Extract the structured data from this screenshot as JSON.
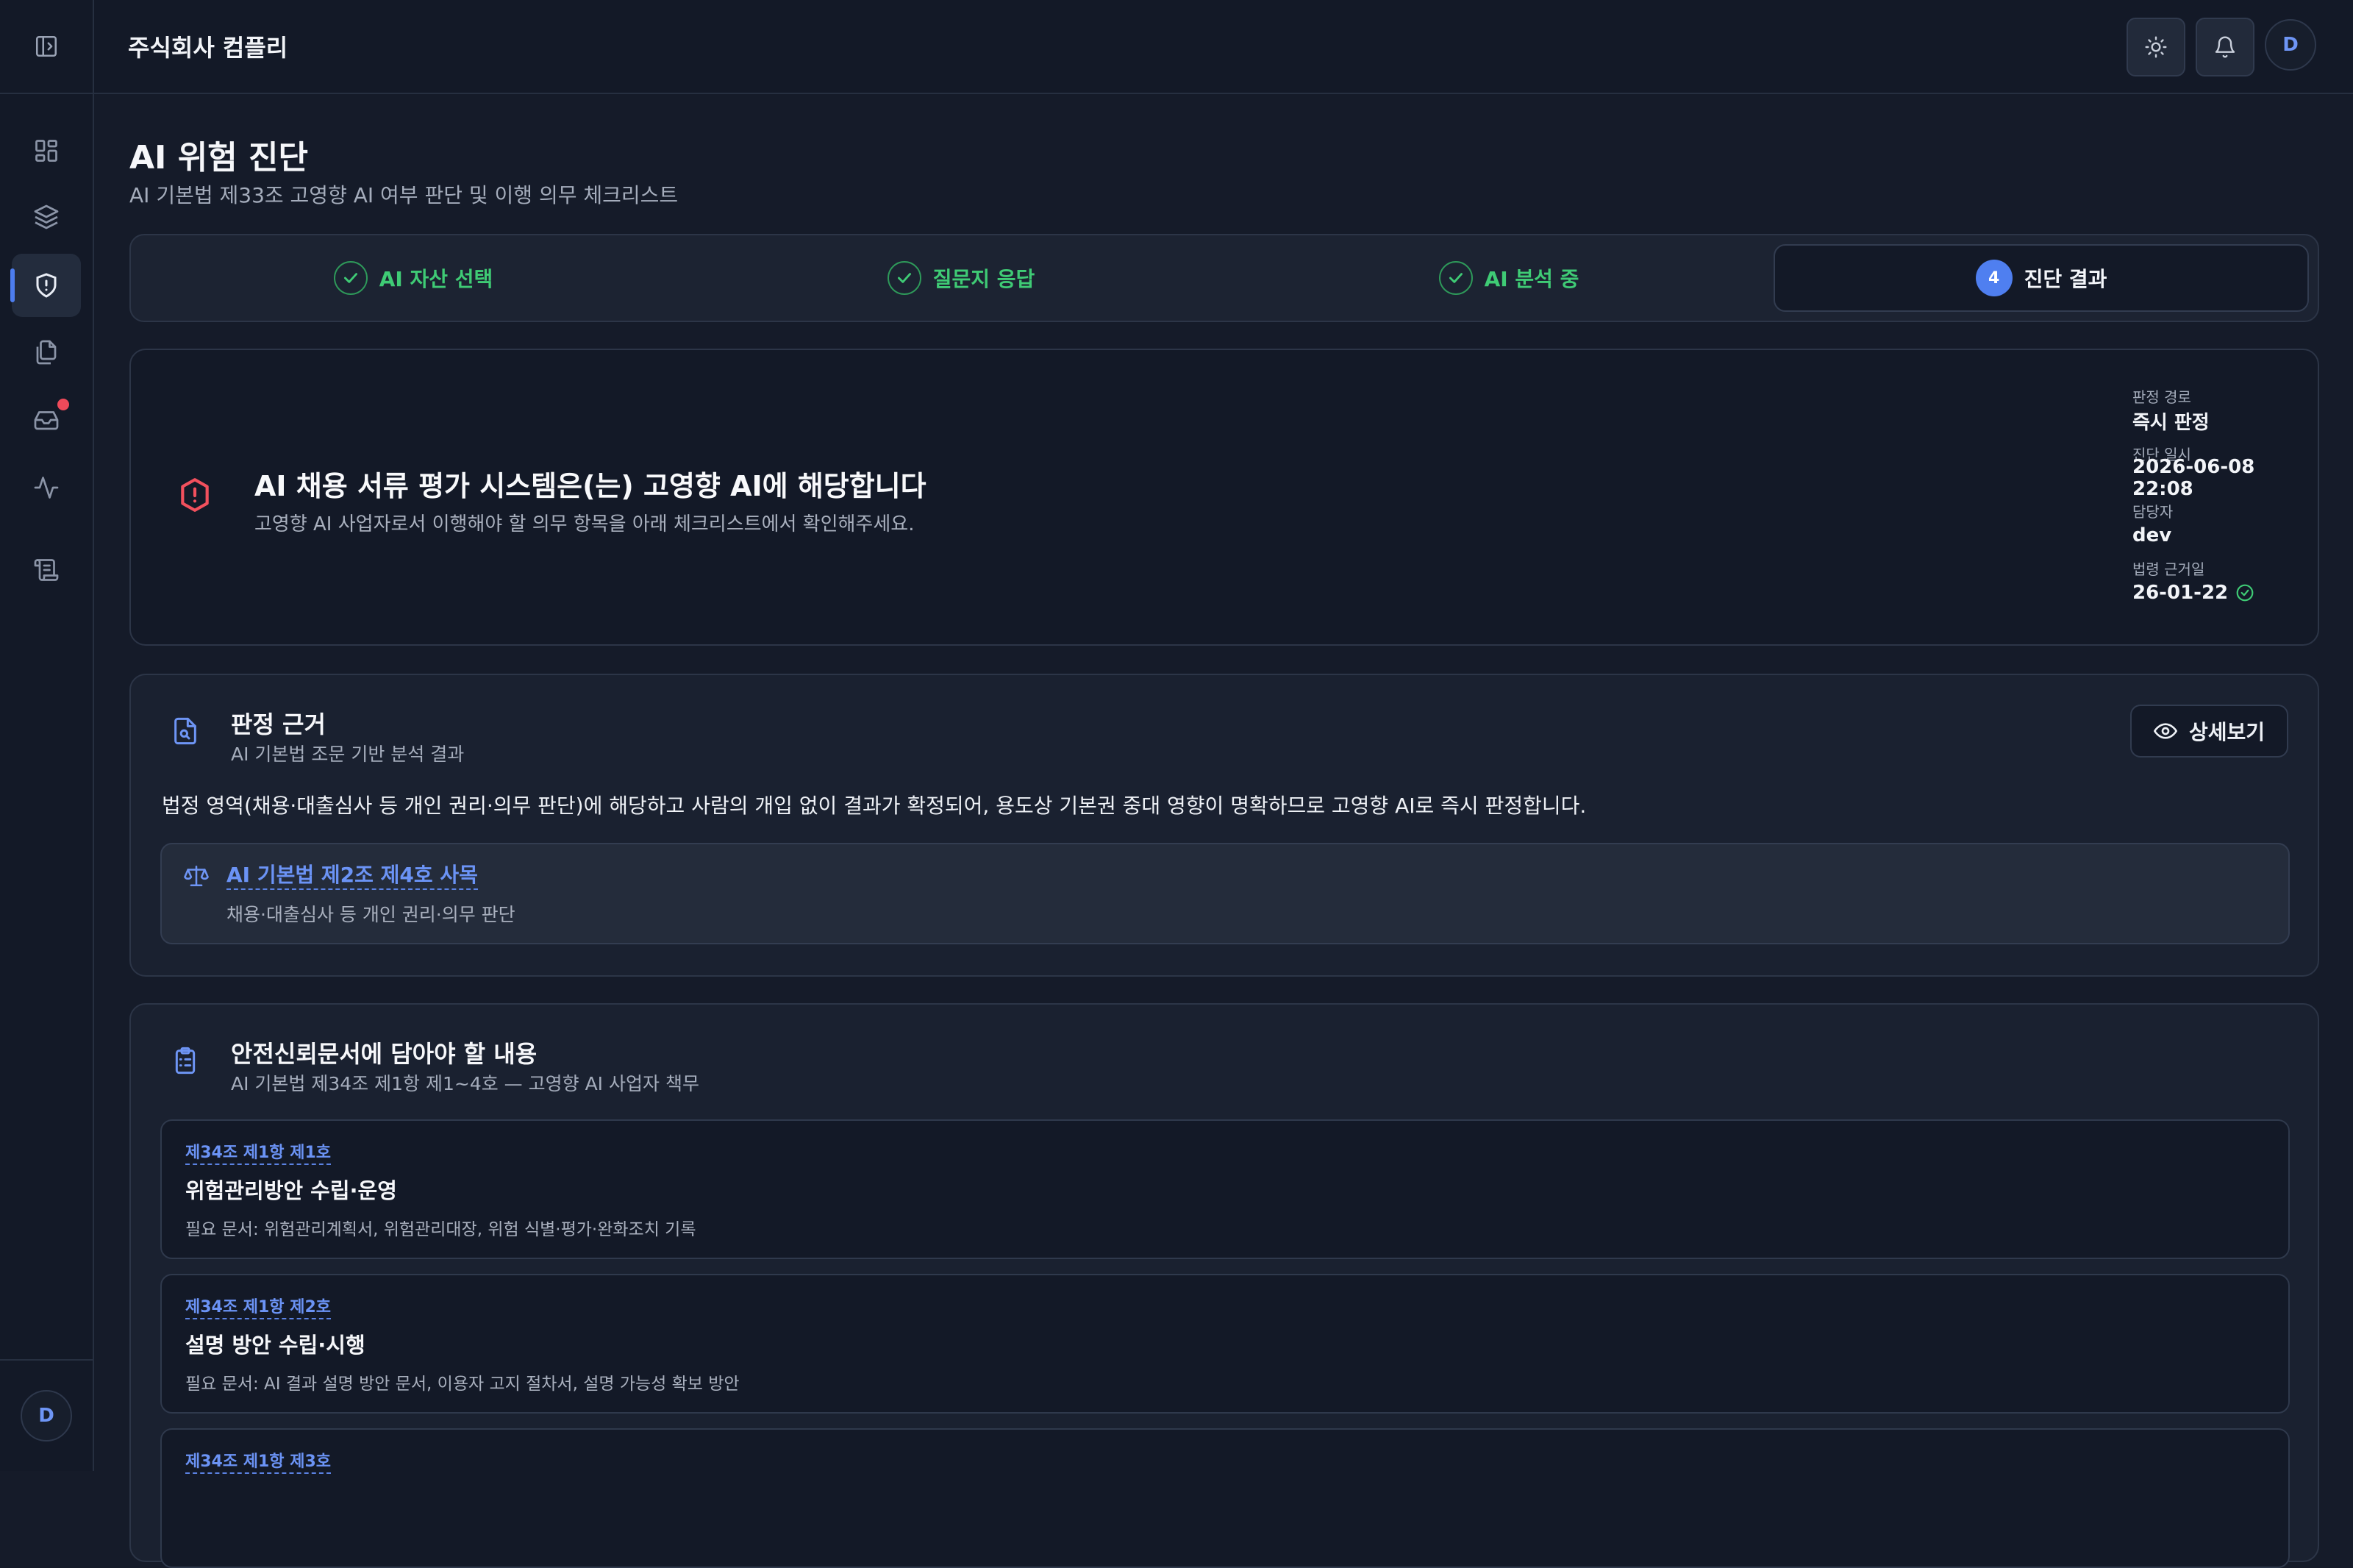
{
  "header": {
    "org_name": "주식회사 컴플리",
    "avatar_initial": "D",
    "icons": [
      "sun-icon",
      "bell-icon"
    ]
  },
  "sidebar": {
    "items": [
      {
        "name": "dashboard",
        "icon": "grid-icon"
      },
      {
        "name": "ai-assets",
        "icon": "layers-icon"
      },
      {
        "name": "risk-diagnosis",
        "icon": "shield-alert-icon",
        "active": true
      },
      {
        "name": "documents",
        "icon": "files-icon"
      },
      {
        "name": "inbox",
        "icon": "inbox-icon",
        "has_notification": true
      },
      {
        "name": "monitoring",
        "icon": "activity-icon"
      },
      {
        "name": "logs",
        "icon": "scroll-icon"
      }
    ],
    "user_initial": "D"
  },
  "page": {
    "title": "AI 위험 진단",
    "subtitle": "AI 기본법 제33조 고영향 AI 여부 판단 및 이행 의무 체크리스트"
  },
  "stepper": {
    "steps": [
      {
        "label": "AI 자산 선택",
        "status": "done"
      },
      {
        "label": "질문지 응답",
        "status": "done"
      },
      {
        "label": "AI 분석 중",
        "status": "done"
      },
      {
        "label": "진단 결과",
        "status": "current",
        "number": "4"
      }
    ]
  },
  "result": {
    "title": "AI 채용 서류 평가 시스템은(는) 고영향 AI에 해당합니다",
    "description": "고영향 AI 사업자로서 이행해야 할 의무 항목을 아래 체크리스트에서 확인해주세요.",
    "meta": {
      "path_label": "판정 경로",
      "path_value": "즉시 판정",
      "date_label": "진단 일시",
      "date_value": "2026-06-08 22:08",
      "owner_label": "담당자",
      "owner_value": "dev",
      "law_date_label": "법령 근거일",
      "law_date_value": "26-01-22"
    }
  },
  "basis": {
    "title": "판정 근거",
    "subtitle": "AI 기본법 조문 기반 분석 결과",
    "detail_button": "상세보기",
    "text": "법정 영역(채용·대출심사 등 개인 권리·의무 판단)에 해당하고 사람의 개입 없이 결과가 확정되어, 용도상 기본권 중대 영향이 명확하므로 고영향 AI로 즉시 판정합니다.",
    "law": {
      "link": "AI 기본법 제2조 제4호 사목",
      "description": "채용·대출심사 등 개인 권리·의무 판단"
    }
  },
  "requirements": {
    "title": "안전신뢰문서에 담아야 할 내용",
    "subtitle": "AI 기본법 제34조 제1항 제1~4호 — 고영향 AI 사업자 책무",
    "items": [
      {
        "ref": "제34조 제1항 제1호",
        "title": "위험관리방안 수립·운영",
        "docs": "필요 문서: 위험관리계획서, 위험관리대장, 위험 식별·평가·완화조치 기록"
      },
      {
        "ref": "제34조 제1항 제2호",
        "title": "설명 방안 수립·시행",
        "docs": "필요 문서: AI 결과 설명 방안 문서, 이용자 고지 절차서, 설명 가능성 확보 방안"
      },
      {
        "ref": "제34조 제1항 제3호",
        "title": "",
        "docs": ""
      }
    ]
  },
  "colors": {
    "accent": "#4f7ff0",
    "success": "#3fcb75",
    "danger": "#f2505d",
    "background": "#151b29"
  }
}
